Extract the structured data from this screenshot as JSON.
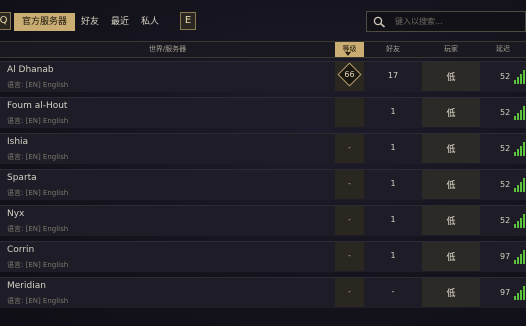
{
  "topbar": {
    "left_button": "Q",
    "tabs": [
      {
        "label": "官方服务器",
        "active": true
      },
      {
        "label": "好友",
        "active": false
      },
      {
        "label": "最近",
        "active": false
      },
      {
        "label": "私人",
        "active": false
      }
    ],
    "e_button": "E",
    "search_placeholder": "键入以搜索..."
  },
  "header": {
    "world": "世界/服务器",
    "level": "等级",
    "friends": "好友",
    "players": "玩家",
    "ping": "延迟"
  },
  "colors": {
    "accent": "#c9ad72",
    "ping_bars": "#5cc43c"
  },
  "rows": [
    {
      "name": "Al Dhanab",
      "lang": "语言: [EN] English",
      "level": "66",
      "friends": "17",
      "players": "低",
      "ping": "52"
    },
    {
      "name": "Foum al-Hout",
      "lang": "语言: [EN] English",
      "level": "",
      "friends": "1",
      "players": "低",
      "ping": "52"
    },
    {
      "name": "Ishia",
      "lang": "语言: [EN] English",
      "level": "-",
      "friends": "1",
      "players": "低",
      "ping": "52"
    },
    {
      "name": "Sparta",
      "lang": "语言: [EN] English",
      "level": "-",
      "friends": "1",
      "players": "低",
      "ping": "52"
    },
    {
      "name": "Nyx",
      "lang": "语言: [EN] English",
      "level": "-",
      "friends": "1",
      "players": "低",
      "ping": "52"
    },
    {
      "name": "Corrin",
      "lang": "语言: [EN] English",
      "level": "-",
      "friends": "1",
      "players": "低",
      "ping": "97"
    },
    {
      "name": "Meridian",
      "lang": "语言: [EN] English",
      "level": "-",
      "friends": "-",
      "players": "低",
      "ping": "97"
    }
  ]
}
